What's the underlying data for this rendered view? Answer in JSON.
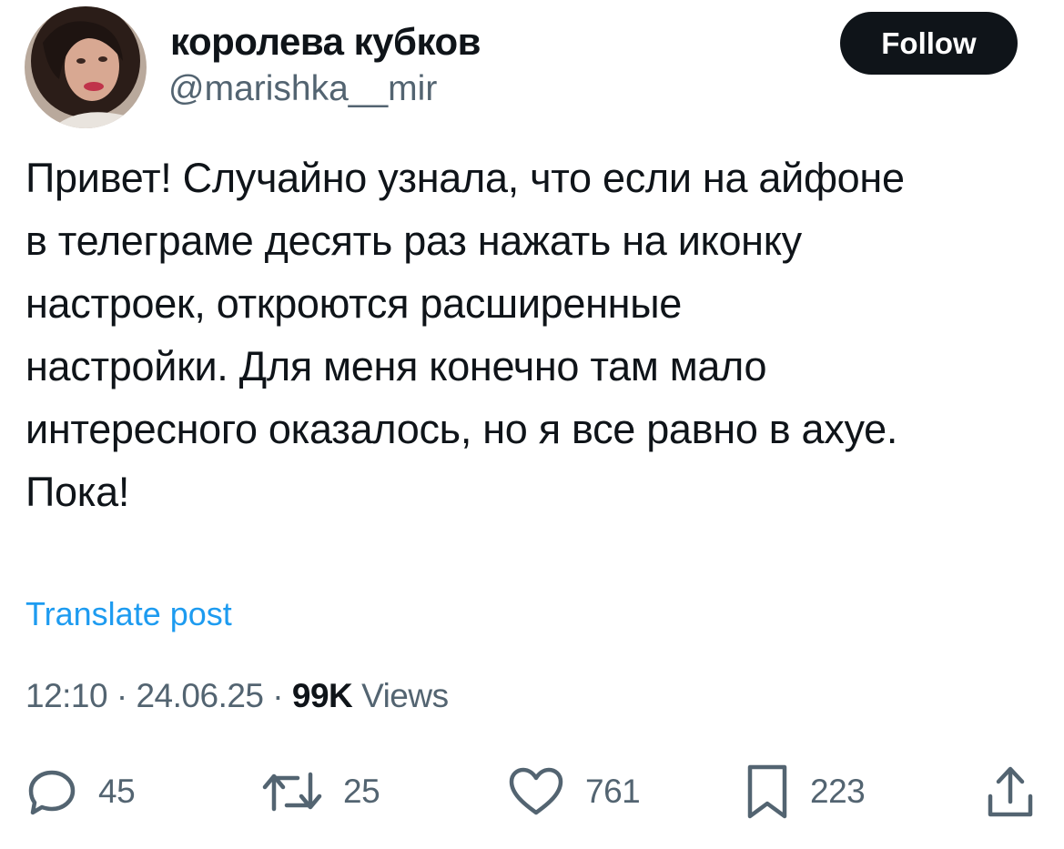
{
  "author": {
    "display_name": "королева кубков",
    "handle": "@marishka__mir",
    "avatar_icon": "user-avatar-photo"
  },
  "follow_label": "Follow",
  "post": {
    "lines": [
      "Привет! Случайно узнала, что если на айфоне",
      "в телеграме десять раз нажать на иконку",
      "настроек, откроются расширенные",
      "настройки. Для меня конечно там мало",
      "интересного оказалось, но я все равно в ахуе.",
      "Пока!"
    ]
  },
  "translate_label": "Translate post",
  "meta": {
    "time": "12:10",
    "separator": " · ",
    "date": "24.06.25",
    "views_count": "99K",
    "views_label": " Views"
  },
  "actions": {
    "replies": {
      "icon": "reply-icon",
      "count": "45"
    },
    "reposts": {
      "icon": "repost-icon",
      "count": "25"
    },
    "likes": {
      "icon": "heart-icon",
      "count": "761"
    },
    "bookmarks": {
      "icon": "bookmark-icon",
      "count": "223"
    },
    "share": {
      "icon": "share-icon"
    }
  },
  "colors": {
    "text": "#0f1419",
    "secondary": "#536471",
    "link": "#1d9bf0",
    "button_bg": "#0f1419"
  }
}
